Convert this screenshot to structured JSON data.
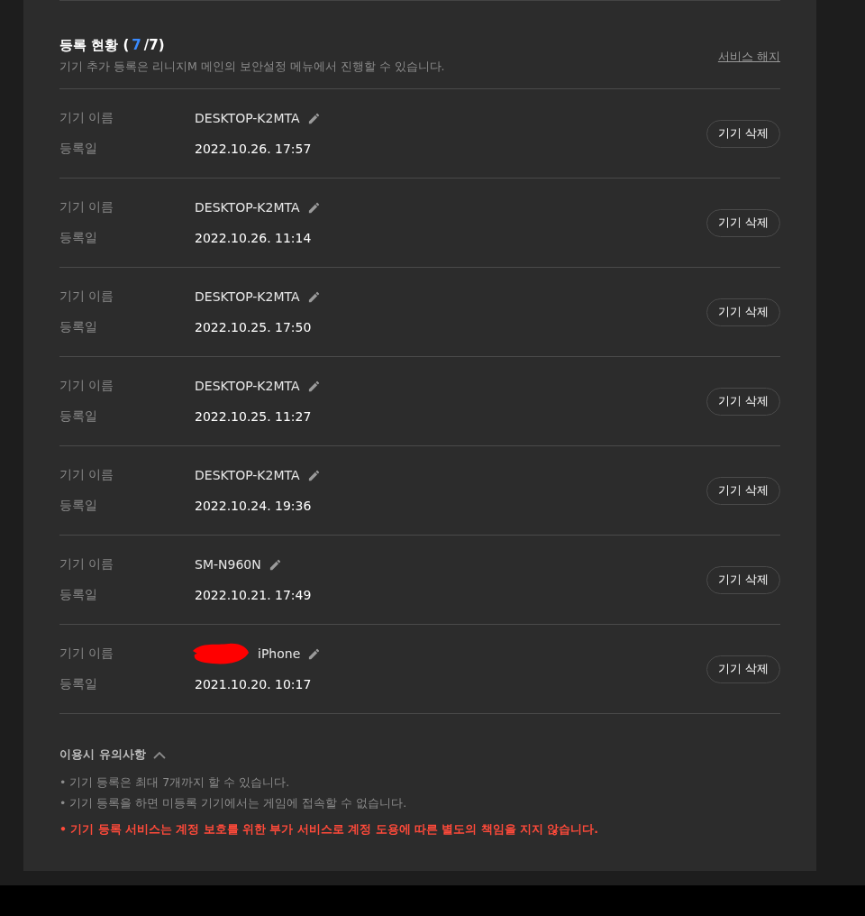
{
  "section": {
    "title": "등록 현황 (",
    "count": "7",
    "total": "/7)",
    "description": "기기 추가 등록은 리니지M 메인의 보안설정 메뉴에서 진행할 수 있습니다.",
    "cancel_link": "서비스 해지"
  },
  "devices": [
    {
      "name_label": "기기 이름",
      "name": "DESKTOP-K2MTA",
      "redacted": false,
      "date_label": "등록일",
      "date": "2022.10.26. 17:57",
      "button": "기기 삭제"
    },
    {
      "name_label": "기기 이름",
      "name": "DESKTOP-K2MTA",
      "redacted": false,
      "date_label": "등록일",
      "date": "2022.10.26. 11:14",
      "button": "기기 삭제"
    },
    {
      "name_label": "기기 이름",
      "name": "DESKTOP-K2MTA",
      "redacted": false,
      "date_label": "등록일",
      "date": "2022.10.25. 17:50",
      "button": "기기 삭제"
    },
    {
      "name_label": "기기 이름",
      "name": "DESKTOP-K2MTA",
      "redacted": false,
      "date_label": "등록일",
      "date": "2022.10.25. 11:27",
      "button": "기기 삭제"
    },
    {
      "name_label": "기기 이름",
      "name": "DESKTOP-K2MTA",
      "redacted": false,
      "date_label": "등록일",
      "date": "2022.10.24. 19:36",
      "button": "기기 삭제"
    },
    {
      "name_label": "기기 이름",
      "name": "SM-N960N",
      "redacted": false,
      "date_label": "등록일",
      "date": "2022.10.21. 17:49",
      "button": "기기 삭제"
    },
    {
      "name_label": "기기 이름",
      "name": "iPhone",
      "redacted": true,
      "date_label": "등록일",
      "date": "2021.10.20. 10:17",
      "button": "기기 삭제"
    }
  ],
  "notice": {
    "title": "이용시 유의사항",
    "expanded": true,
    "items": [
      {
        "kind": "normal",
        "text": "• 기기 등록은 최대 7개까지 할 수 있습니다."
      },
      {
        "kind": "normal",
        "text": "• 기기 등록을 하면 미등록 기기에서는 게임에 접속할 수 없습니다."
      },
      {
        "kind": "warning",
        "text": "• 기기 등록 서비스는 계정 보호를 위한 부가 서비스로 계정 도용에 따른 별도의 책임을 지지 않습니다."
      }
    ]
  }
}
